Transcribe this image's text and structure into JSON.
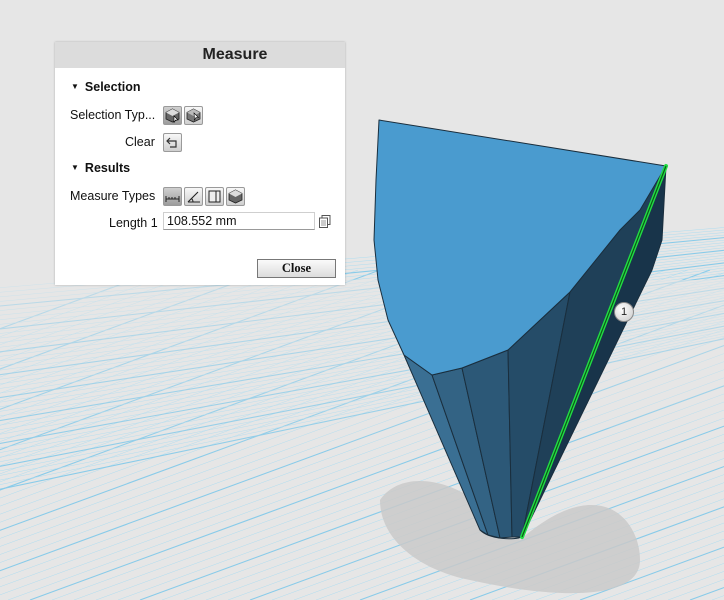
{
  "panel": {
    "title": "Measure",
    "selection": {
      "header": "Selection",
      "type_label": "Selection Typ...",
      "clear_label": "Clear"
    },
    "results": {
      "header": "Results",
      "types_label": "Measure Types",
      "length_label": "Length 1",
      "length_value": "108.552 mm"
    },
    "close_label": "Close"
  },
  "viewport": {
    "callout_number": "1",
    "model_top_color": "#4a9bcf",
    "model_side_color": "#2f5d7e",
    "highlight_color": "#22dd44",
    "grid_color": "#7fc9ea"
  },
  "icons": {
    "selection_types": [
      "body-select-icon",
      "face-select-icon"
    ],
    "clear": "clear-selection-icon",
    "measure_types": [
      "distance-icon",
      "angle-icon",
      "area-icon",
      "volume-icon"
    ],
    "copy": "copy-icon"
  }
}
